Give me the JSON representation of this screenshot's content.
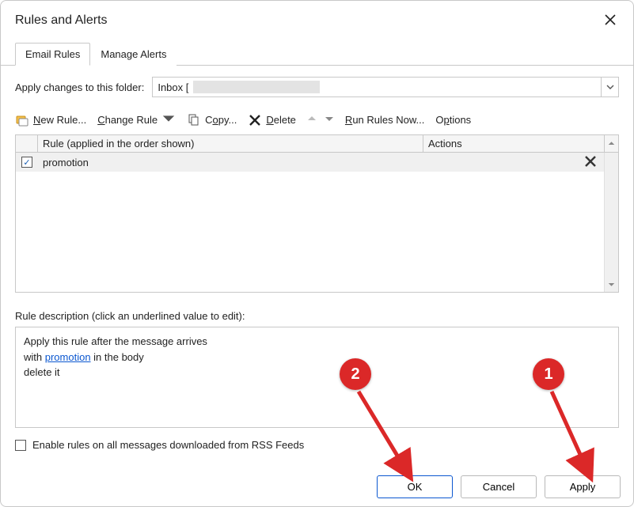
{
  "window": {
    "title": "Rules and Alerts"
  },
  "tabs": {
    "email_rules": "Email Rules",
    "manage_alerts": "Manage Alerts"
  },
  "folder": {
    "label": "Apply changes to this folder:",
    "value": "Inbox ["
  },
  "toolbar": {
    "new_rule": "New Rule...",
    "change_rule": "Change Rule",
    "copy": "Copy...",
    "delete": "Delete",
    "run_rules_now": "Run Rules Now...",
    "options": "Options"
  },
  "table": {
    "header_rule": "Rule (applied in the order shown)",
    "header_actions": "Actions",
    "rows": [
      {
        "name": "promotion",
        "checked": true,
        "action_icon": "delete-x-icon"
      }
    ]
  },
  "description": {
    "label": "Rule description (click an underlined value to edit):",
    "line1": "Apply this rule after the message arrives",
    "line2_prefix": "with ",
    "line2_link": "promotion",
    "line2_suffix": " in the body",
    "line3": "delete it"
  },
  "rss": {
    "label": "Enable rules on all messages downloaded from RSS Feeds"
  },
  "buttons": {
    "ok": "OK",
    "cancel": "Cancel",
    "apply": "Apply"
  },
  "annotations": {
    "badge1": "1",
    "badge2": "2"
  }
}
